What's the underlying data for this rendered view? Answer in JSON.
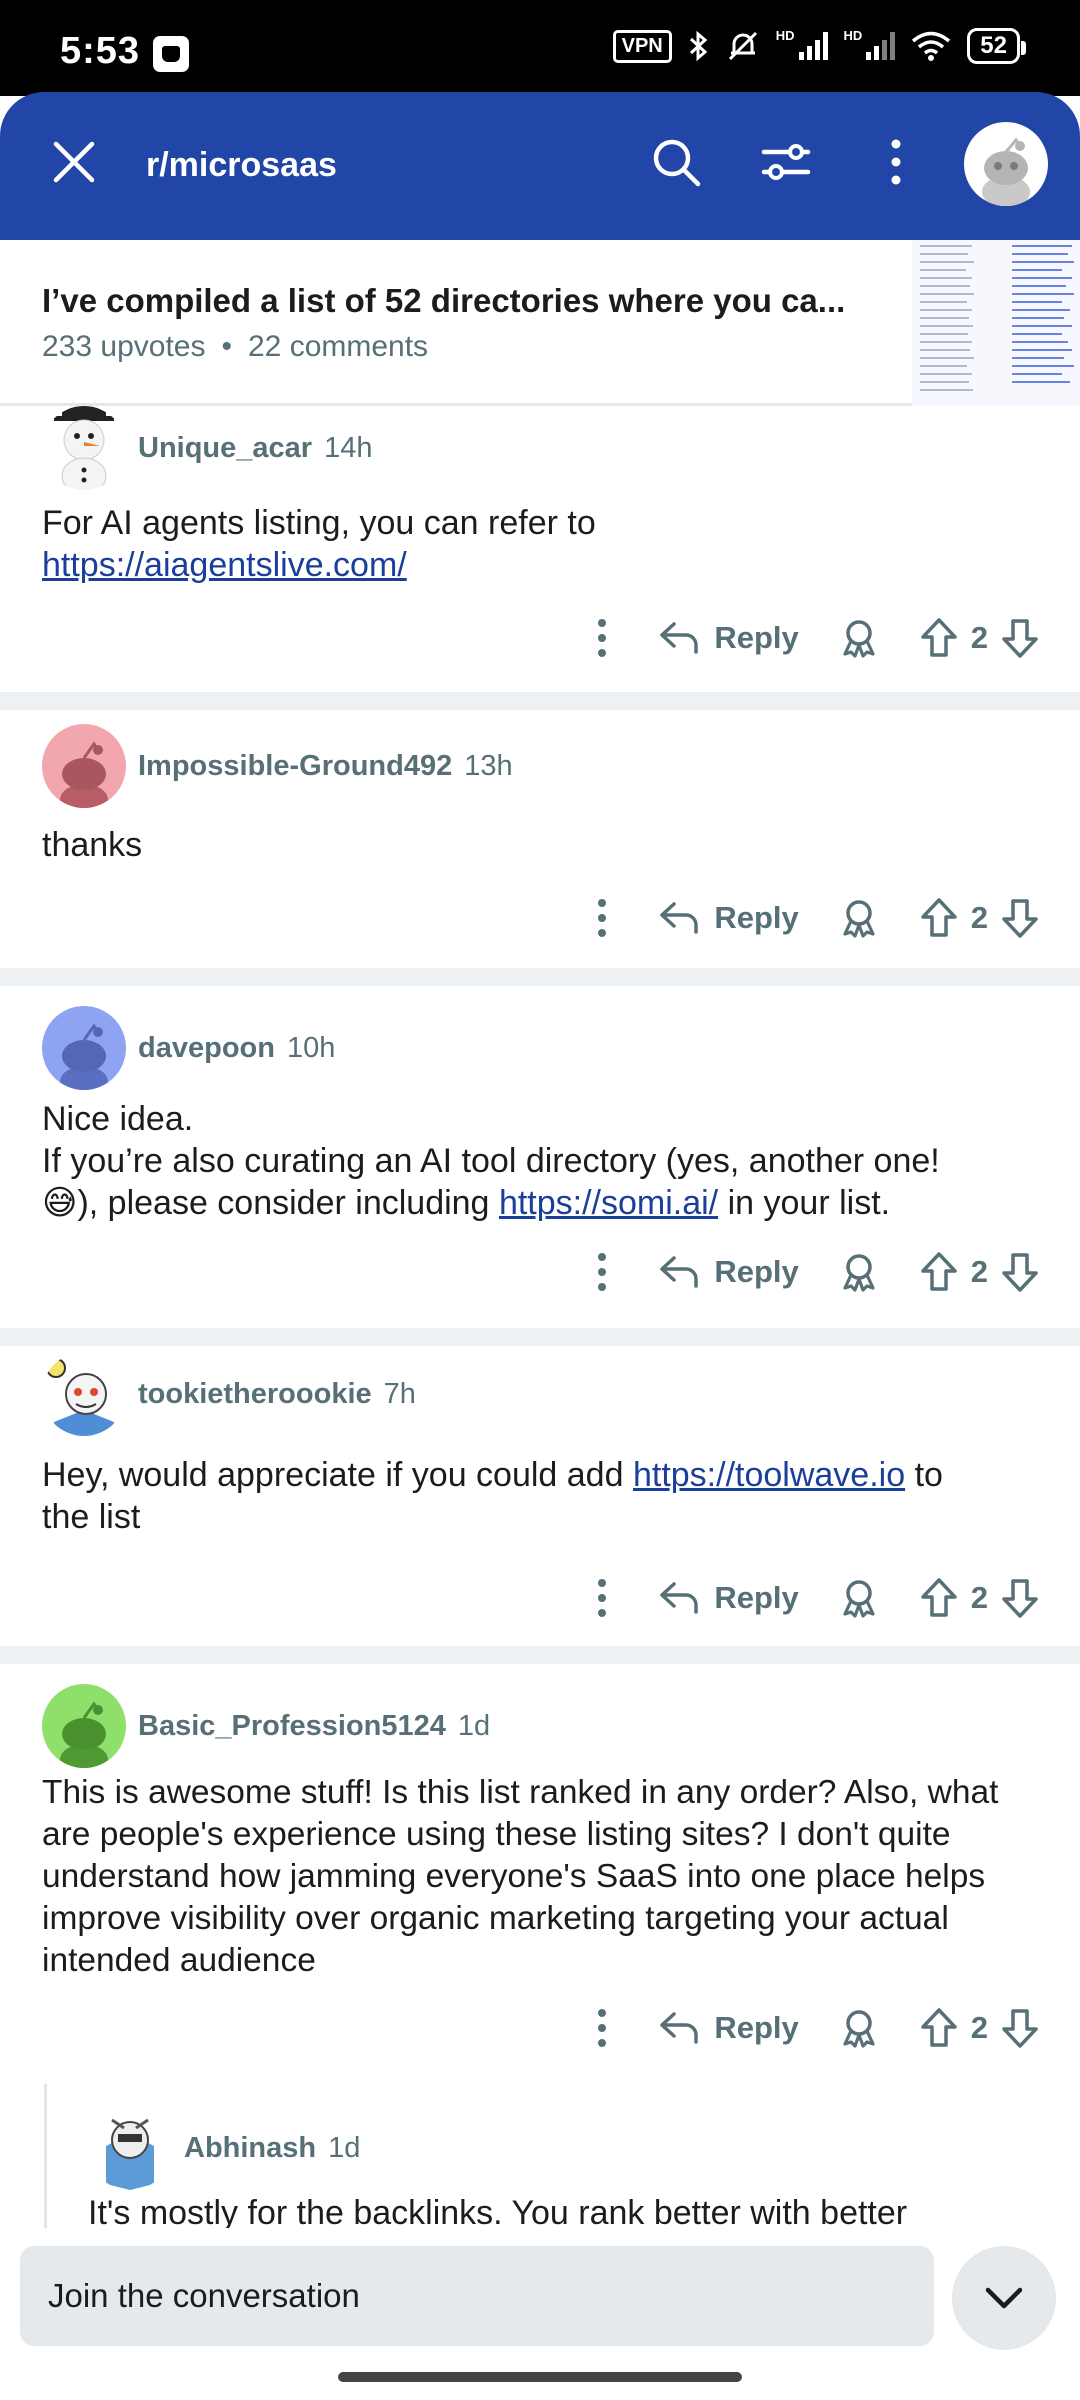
{
  "status": {
    "time": "5:53",
    "vpn": "VPN",
    "hd1": "HD",
    "hd2": "HD",
    "battery": "52"
  },
  "header": {
    "subreddit": "r/microsaas",
    "icons": [
      "close-icon",
      "search-icon",
      "sort-filter-icon",
      "more-vertical-icon",
      "avatar"
    ],
    "color": "#2146a7"
  },
  "post": {
    "title": "I’ve compiled a list of 52 directories where you ca...",
    "upvotes": "233 upvotes",
    "dot": "•",
    "comments": "22 comments"
  },
  "actions": {
    "reply_label": "Reply"
  },
  "comments": [
    {
      "user": "Unique_acar",
      "time": "14h",
      "body_text": "For AI agents listing, you can refer to",
      "link": "https://aiagentslive.com/",
      "score": "2",
      "avatar_color": "#ffffff"
    },
    {
      "user": "Impossible-Ground492",
      "time": "13h",
      "body_text": "thanks",
      "score": "2",
      "avatar_color": "#f2a7ae"
    },
    {
      "user": "davepoon",
      "time": "10h",
      "line1": "Nice idea.",
      "line2": "If you’re also curating an AI tool directory (yes, another one!",
      "emoji": "😅",
      "line3a": "), please consider including",
      "link": "https://somi.ai/",
      "line3b": "in your list.",
      "score": "2",
      "avatar_color": "#8fa3f3"
    },
    {
      "user": "tookietheroookie",
      "time": "7h",
      "body_a": "Hey, would appreciate if you could add",
      "link": "https://toolwave.io",
      "body_b": "to",
      "body_c": "the list",
      "score": "2",
      "avatar_color": "#ffffff"
    },
    {
      "user": "Basic_Profession5124",
      "time": "1d",
      "body_text": "This is awesome stuff! Is this list ranked in any order? Also, what are people's experience using these listing sites? I don't quite understand how jamming everyone's SaaS into one place helps improve visibility over organic marketing targeting your actual intended audience",
      "score": "2",
      "avatar_color": "#8ee06b"
    },
    {
      "user": "Abhinash",
      "time": "1d",
      "body_text": "It's mostly for the backlinks. You rank better with better",
      "avatar_color": "#ffffff"
    }
  ],
  "bottom": {
    "placeholder": "Join the conversation"
  }
}
